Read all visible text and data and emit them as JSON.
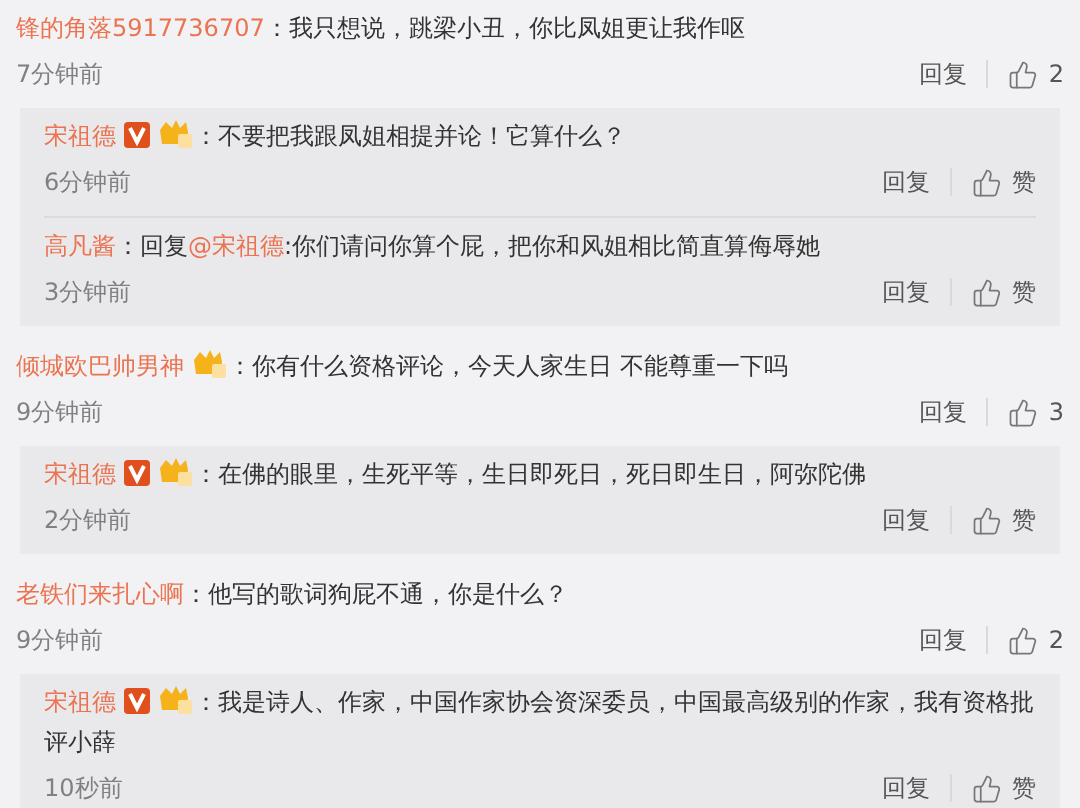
{
  "comments": [
    {
      "user": "锋的角落5917736707",
      "segments": [
        {
          "kind": "plain",
          "text": "：我只想说，跳梁小丑，你比凤姐更让我作呕"
        }
      ],
      "time": "7分钟前",
      "reply_label": "回复",
      "likes": "2",
      "replies": [
        {
          "user": "宋祖德",
          "badges": [
            {
              "kind": "verified"
            },
            {
              "kind": "vip"
            }
          ],
          "segments": [
            {
              "kind": "plain",
              "text": "：不要把我跟凤姐相提并论！它算什么？"
            }
          ],
          "time": "6分钟前",
          "reply_label": "回复",
          "likes": "赞"
        },
        {
          "user": "高凡酱",
          "segments": [
            {
              "kind": "plain",
              "text": "：回复"
            },
            {
              "kind": "mention",
              "text": "@宋祖德"
            },
            {
              "kind": "plain",
              "text": ":你们请问你算个屁，把你和风姐相比简直算侮辱她"
            }
          ],
          "time": "3分钟前",
          "reply_label": "回复",
          "likes": "赞"
        }
      ]
    },
    {
      "user": "倾城欧巴帅男神",
      "badges": [
        {
          "kind": "vip"
        }
      ],
      "segments": [
        {
          "kind": "plain",
          "text": "：你有什么资格评论，今天人家生日 不能尊重一下吗"
        }
      ],
      "time": "9分钟前",
      "reply_label": "回复",
      "likes": "3",
      "replies": [
        {
          "user": "宋祖德",
          "badges": [
            {
              "kind": "verified"
            },
            {
              "kind": "vip"
            }
          ],
          "segments": [
            {
              "kind": "plain",
              "text": "：在佛的眼里，生死平等，生日即死日，死日即生日，阿弥陀佛"
            }
          ],
          "time": "2分钟前",
          "reply_label": "回复",
          "likes": "赞"
        }
      ]
    },
    {
      "user": "老铁们来扎心啊",
      "segments": [
        {
          "kind": "plain",
          "text": "：他写的歌词狗屁不通，你是什么？"
        }
      ],
      "time": "9分钟前",
      "reply_label": "回复",
      "likes": "2",
      "replies": [
        {
          "user": "宋祖德",
          "badges": [
            {
              "kind": "verified"
            },
            {
              "kind": "vip"
            }
          ],
          "segments": [
            {
              "kind": "plain",
              "text": "：我是诗人、作家，中国作家协会资深委员，中国最高级别的作家，我有资格批评小薛"
            }
          ],
          "time": "10秒前",
          "reply_label": "回复",
          "likes": "赞"
        }
      ]
    }
  ]
}
